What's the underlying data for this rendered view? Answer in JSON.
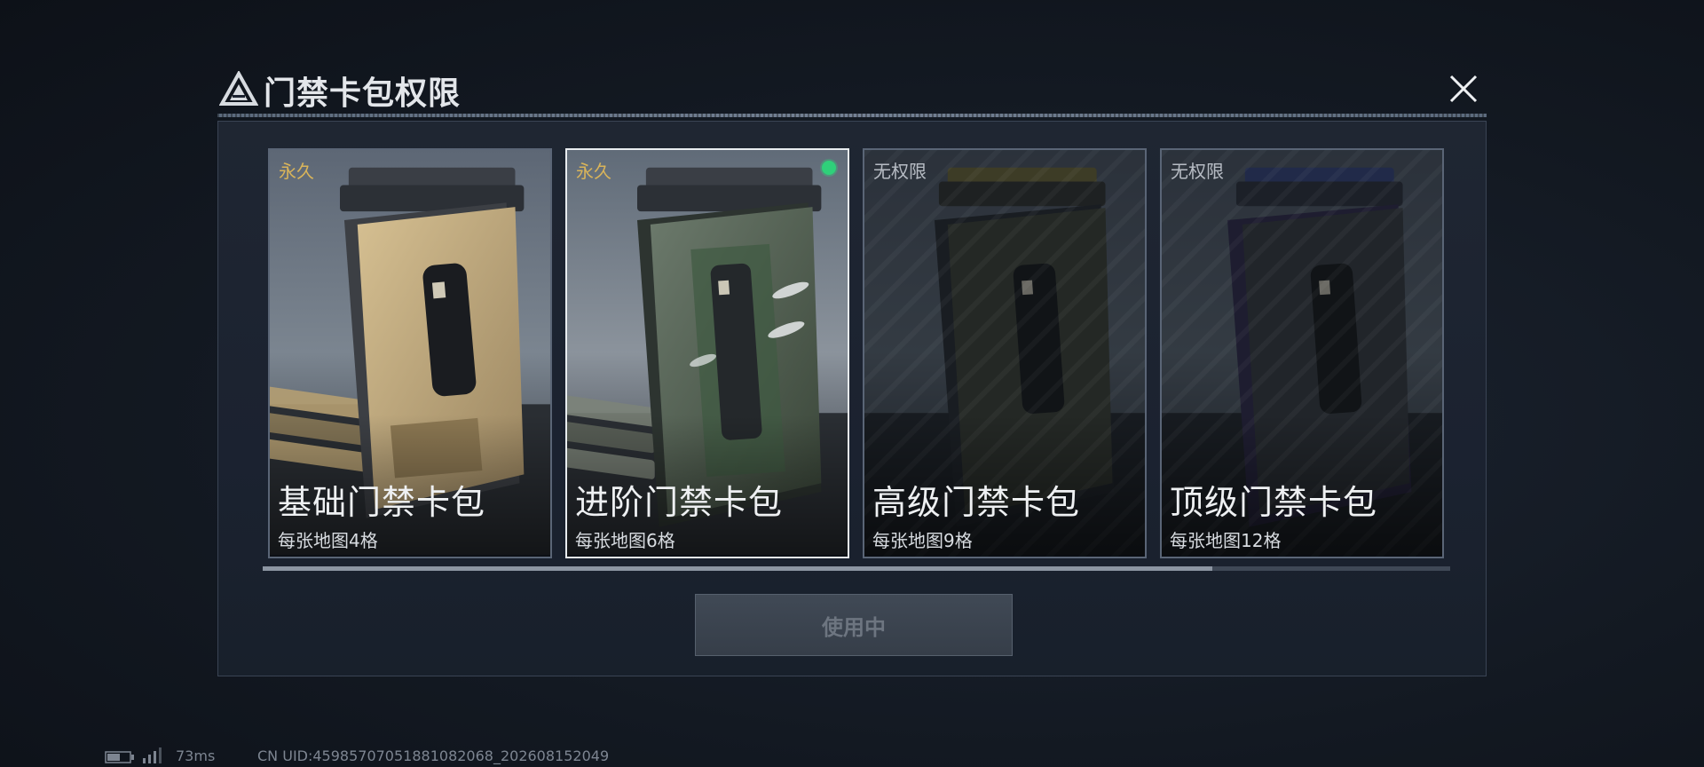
{
  "header": {
    "title": "门禁卡包权限",
    "logo_icon": "triangle-logo-icon",
    "close_icon": "close-icon"
  },
  "cards": [
    {
      "tag": "永久",
      "name": "基础门禁卡包",
      "desc": "每张地图4格",
      "status": "owned",
      "accent": "#c9b27e",
      "selected": false
    },
    {
      "tag": "永久",
      "name": "进阶门禁卡包",
      "desc": "每张地图6格",
      "status": "owned",
      "accent": "#4f6a55",
      "selected": true,
      "active_indicator_color": "#2fd07a"
    },
    {
      "tag": "无权限",
      "name": "高级门禁卡包",
      "desc": "每张地图9格",
      "status": "locked",
      "accent": "#3a3d2e",
      "selected": false
    },
    {
      "tag": "无权限",
      "name": "顶级门禁卡包",
      "desc": "每张地图12格",
      "status": "locked",
      "accent": "#2e3450",
      "selected": false
    }
  ],
  "scroll_position": 0.8,
  "action_button": {
    "label": "使用中",
    "disabled": true
  },
  "statusbar": {
    "battery_icon": "battery-icon",
    "signal_icon": "signal-icon",
    "ping": "73ms",
    "uid": "CN UID:4598570705188108​2068_202608152049"
  },
  "colors": {
    "permanent_tag": "#d9b45a",
    "locked_tag": "#b7bcc4",
    "selected_border": "#e8ecef",
    "card_border": "#5a6576"
  }
}
